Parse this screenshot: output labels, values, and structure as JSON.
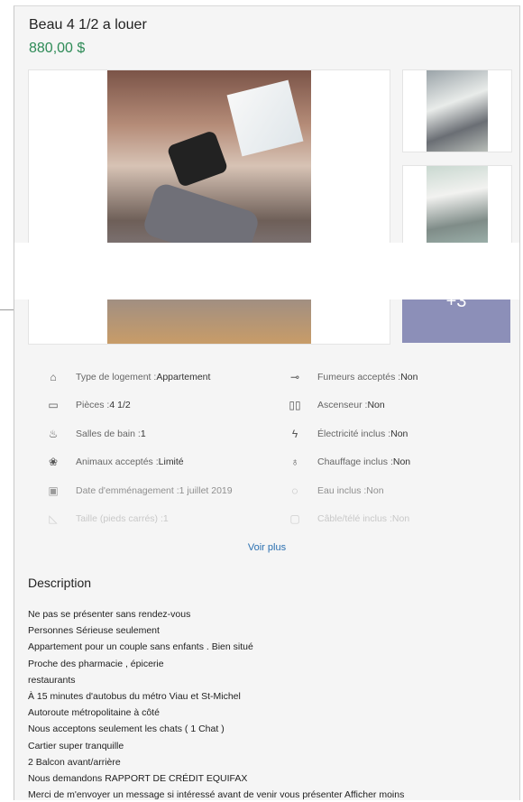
{
  "listing": {
    "title": "Beau 4 1/2 a louer",
    "price": "880,00 $"
  },
  "gallery": {
    "more_count": "+3"
  },
  "features": {
    "left": [
      {
        "icon": "house-icon",
        "glyph": "⌂",
        "label": "Type de logement : ",
        "value": "Appartement"
      },
      {
        "icon": "bed-icon",
        "glyph": "▭",
        "label": "Pièces : ",
        "value": "4 1/2"
      },
      {
        "icon": "bathtub-icon",
        "glyph": "♨",
        "label": "Salles de bain : ",
        "value": "1"
      },
      {
        "icon": "paw-icon",
        "glyph": "❀",
        "label": "Animaux acceptés : ",
        "value": "Limité"
      },
      {
        "icon": "calendar-icon",
        "glyph": "▣",
        "label": "Date d'emménagement : ",
        "value": "1 juillet 2019"
      },
      {
        "icon": "ruler-icon",
        "glyph": "◺",
        "label": "Taille (pieds carrés) : ",
        "value": "1"
      }
    ],
    "right": [
      {
        "icon": "cigarette-icon",
        "glyph": "⊸",
        "label": "Fumeurs acceptés : ",
        "value": "Non"
      },
      {
        "icon": "elevator-icon",
        "glyph": "▯▯",
        "label": "Ascenseur : ",
        "value": "Non"
      },
      {
        "icon": "lightning-icon",
        "glyph": "ϟ",
        "label": "Électricité inclus : ",
        "value": "Non"
      },
      {
        "icon": "flame-icon",
        "glyph": "♁",
        "label": "Chauffage inclus : ",
        "value": "Non"
      },
      {
        "icon": "water-drop-icon",
        "glyph": "◌",
        "label": "Eau inclus : ",
        "value": "Non"
      },
      {
        "icon": "tv-icon",
        "glyph": "▢",
        "label": "Câble/télé inclus : ",
        "value": "Non"
      }
    ],
    "voir_plus": "Voir plus"
  },
  "description": {
    "heading": "Description",
    "lines": [
      "Ne pas se présenter sans rendez-vous",
      "Personnes Sérieuse seulement",
      "Appartement pour un couple sans enfants . Bien situé",
      "Proche des pharmacie , épicerie",
      "restaurants",
      "À 15 minutes d'autobus du métro Viau et St-Michel",
      "Autoroute métropolitaine à côté",
      "Nous acceptons seulement les chats ( 1 Chat )",
      "Cartier super tranquille",
      "2 Balcon avant/arrière",
      "Nous demandons RAPPORT DE CRÉDIT EQUIFAX",
      "Merci de m'envoyer un message si intéressé avant de venir vous présenter Afficher moins"
    ]
  }
}
